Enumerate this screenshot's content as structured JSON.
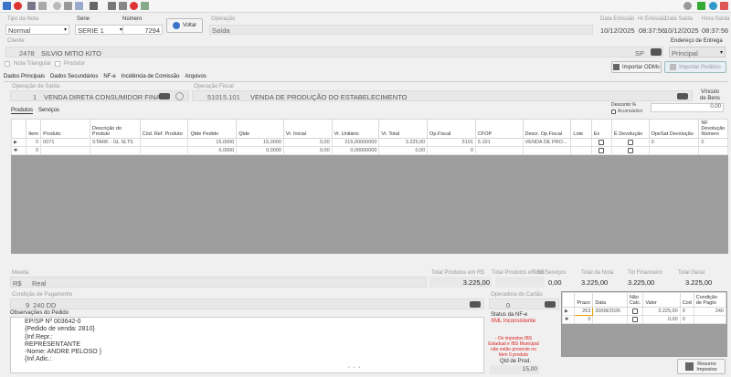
{
  "header": {
    "tipo_label": "Tipo da Nota",
    "tipo_value": "Normal",
    "serie_label": "Série",
    "serie_value": "SERIE 1",
    "numero_label": "Número",
    "numero_value": "7294",
    "voltar_label": "Voltar",
    "operacao_label": "Operação",
    "operacao_value": "Saída",
    "dt_emissao_label": "Data Emissão",
    "dt_emissao_value": "10/12/2025",
    "hr_emissao_label": "Hr Emissão",
    "hr_emissao_value": "08:37:56",
    "dt_saida_label": "Data Saída",
    "dt_saida_value": "10/12/2025",
    "hr_saida_label": "Hora Saída",
    "hr_saida_value": "08:37:56"
  },
  "cliente": {
    "label": "Cliente",
    "code": "2478",
    "name": "SILVIO MITIO KITO",
    "uf": "SP"
  },
  "entrega": {
    "label": "Endereço de Entrega",
    "value": "Principal"
  },
  "checks": {
    "nota_triangular": "Nota Triangular",
    "produtor": "Produtor"
  },
  "buttons": {
    "importar_odms": "Importar ODMs",
    "importar_pedidos": "Importar Pedidos",
    "vinculo_line1": "Vínculo",
    "vinculo_line2": "de Bens",
    "resumo_line1": "Resumo",
    "resumo_line2": "Impostos"
  },
  "main_tabs": [
    "Dados Principais",
    "Dados Secundários",
    "NF-e",
    "Incidência de Comissão",
    "Arquivos"
  ],
  "op_saida": {
    "label": "Operação de Saída",
    "code": "1",
    "value": "VENDA DIRETA CONSUMIDOR FINA"
  },
  "op_fiscal": {
    "label": "Operação Fiscal",
    "code1": "5101",
    "code2": "5.101",
    "value": "VENDA DE PRODUÇÃO DO ESTABELECIMENTO"
  },
  "desconto": {
    "label": "Desconto %",
    "acum": "Acumulativo",
    "value": "0,00"
  },
  "sub_tabs": [
    "Produtos",
    "Serviços"
  ],
  "grid": {
    "headers": [
      "Item",
      "Produto",
      "Descrição do Produto",
      "Cód. Ref. Produto",
      "Qtde Pedido",
      "Qtde",
      "Vr. Inicial",
      "Vr. Unitário",
      "Vr. Total",
      "Op.Fiscal",
      "CFOP",
      "Descr. Op.Fiscal",
      "Lote",
      "Ex",
      "É Devolução",
      "OpeSat Devolução",
      "NF Devolução Número"
    ],
    "rows": [
      [
        "0",
        "0071",
        "STARK - GL SLTS",
        "",
        "15,0000",
        "15,0000",
        "0,00",
        "215,00000000",
        "3.225,00",
        "5101",
        "5.101",
        "VENDA DE PRO...",
        "",
        "",
        "",
        "0",
        "0"
      ],
      [
        "0",
        "",
        "",
        "",
        "0,0000",
        "0,0000",
        "0,00",
        "0,00000000",
        "0,00",
        "0",
        "",
        "",
        "",
        "",
        "",
        "",
        ""
      ]
    ]
  },
  "moeda": {
    "label": "Moeda",
    "symbol": "R$",
    "value": "Real"
  },
  "totals": {
    "prod_rl_label": "Total Produtos em R$",
    "prod_rl_value": "3.225,00",
    "prod_rl2_label": "Total Produtos em R$",
    "prod_rl2_value": "",
    "serv_label": "Total Serviços",
    "serv_value": "0,00",
    "nota_label": "Total da Nota",
    "nota_value": "3.225,00",
    "fin_label": "Tot Financeiro",
    "fin_value": "3.225,00",
    "geral_label": "Total Geral",
    "geral_value": "3.225,00"
  },
  "cond_pag": {
    "label": "Condição de Pagamento",
    "code": "9",
    "value": "240 DD"
  },
  "operador": {
    "label": "Operadora do Cartão",
    "value": "0"
  },
  "obs": {
    "label": "Observações do Pedido",
    "lines": [
      "EP/SP Nº 003642-0",
      "{Pedido de venda: 2810}",
      "{Inf.Repr.:",
      "REPRESENTANTE",
      "-Nome: ANDRE PELOSO }",
      "{Inf.Adic.:"
    ]
  },
  "status": {
    "label": "Status da NF-e",
    "value": "XML Inconsistente",
    "warning": "- Os impostos IBS Estadual e IBS Municipal não estão presente no Item 0 produto"
  },
  "qtd_prod": {
    "label": "Qtd de Prod.",
    "value": "15,00"
  },
  "parcelas": {
    "headers": [
      "Prazo",
      "Data",
      "Não Calc.",
      "Valor",
      "Cod",
      "Condição de Pagto"
    ],
    "rows": [
      [
        "263",
        "30/08/2026",
        "",
        "3.225,00",
        "9",
        "240"
      ],
      [
        "0",
        "",
        "",
        "0,00",
        "0",
        ""
      ]
    ]
  }
}
